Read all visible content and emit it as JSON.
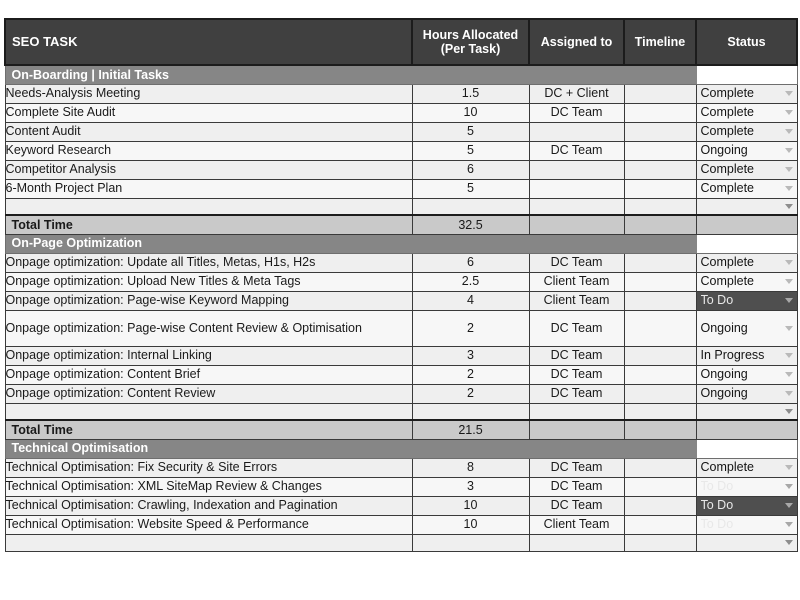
{
  "table": {
    "columns": [
      {
        "key": "task",
        "label": "SEO TASK"
      },
      {
        "key": "hours",
        "label": "Hours Allocated",
        "label_line2": "(Per Task)"
      },
      {
        "key": "assigned",
        "label": "Assigned to"
      },
      {
        "key": "timeline",
        "label": "Timeline"
      },
      {
        "key": "status",
        "label": "Status"
      }
    ],
    "total_label": "Total Time",
    "colors": {
      "header_bg": "#404040",
      "header_text": "#ffffff",
      "section_bg": "#868686",
      "total_bg": "#c9c9c9",
      "row_bg": "#efefef",
      "row_bg_alt": "#f7f7f7",
      "status_default_bg": "#8a8a8a",
      "status_todo_bg": "#4f4f4f",
      "grid_line": "#3a3a3a"
    },
    "sections": [
      {
        "title": "On-Boarding | Initial Tasks",
        "total": "32.5",
        "rows": [
          {
            "task": "Needs-Analysis Meeting",
            "hours": "1.5",
            "assigned": "DC + Client",
            "timeline": "",
            "status": "Complete"
          },
          {
            "task": "Complete Site Audit",
            "hours": "10",
            "assigned": "DC Team",
            "timeline": "",
            "status": "Complete"
          },
          {
            "task": "Content Audit",
            "hours": "5",
            "assigned": "",
            "timeline": "",
            "status": "Complete"
          },
          {
            "task": "Keyword Research",
            "hours": "5",
            "assigned": "DC Team",
            "timeline": "",
            "status": "Ongoing"
          },
          {
            "task": "Competitor Analysis",
            "hours": "6",
            "assigned": "",
            "timeline": "",
            "status": "Complete"
          },
          {
            "task": "6-Month Project Plan",
            "hours": "5",
            "assigned": "",
            "timeline": "",
            "status": "Complete"
          }
        ]
      },
      {
        "title": "On-Page Optimization",
        "total": "21.5",
        "rows": [
          {
            "task": "Onpage optimization: Update all Titles, Metas, H1s, H2s",
            "hours": "6",
            "assigned": "DC Team",
            "timeline": "",
            "status": "Complete"
          },
          {
            "task": "Onpage optimization: Upload New Titles & Meta Tags",
            "hours": "2.5",
            "assigned": "Client Team",
            "timeline": "",
            "status": "Complete"
          },
          {
            "task": "Onpage optimization: Page-wise Keyword Mapping",
            "hours": "4",
            "assigned": "Client Team",
            "timeline": "",
            "status": "To Do"
          },
          {
            "task": "Onpage optimization: Page-wise Content Review & Optimisation",
            "hours": "2",
            "assigned": "DC Team",
            "timeline": "",
            "status": "Ongoing",
            "tall": true
          },
          {
            "task": "Onpage optimization: Internal Linking",
            "hours": "3",
            "assigned": "DC Team",
            "timeline": "",
            "status": "In Progress"
          },
          {
            "task": "Onpage optimization: Content Brief",
            "hours": "2",
            "assigned": "DC Team",
            "timeline": "",
            "status": "Ongoing"
          },
          {
            "task": "Onpage optimization: Content Review",
            "hours": "2",
            "assigned": "DC Team",
            "timeline": "",
            "status": "Ongoing"
          }
        ]
      },
      {
        "title": "Technical Optimisation",
        "total": null,
        "rows": [
          {
            "task": "Technical Optimisation: Fix Security & Site Errors",
            "hours": "8",
            "assigned": "DC Team",
            "timeline": "",
            "status": "Complete"
          },
          {
            "task": "Technical Optimisation: XML SiteMap Review & Changes",
            "hours": "3",
            "assigned": "DC Team",
            "timeline": "",
            "status": "To Do"
          },
          {
            "task": "Technical Optimisation: Crawling, Indexation and Pagination",
            "hours": "10",
            "assigned": "DC Team",
            "timeline": "",
            "status": "To Do"
          },
          {
            "task": "Technical Optimisation: Website Speed & Performance",
            "hours": "10",
            "assigned": "Client Team",
            "timeline": "",
            "status": "To Do"
          }
        ]
      }
    ]
  }
}
